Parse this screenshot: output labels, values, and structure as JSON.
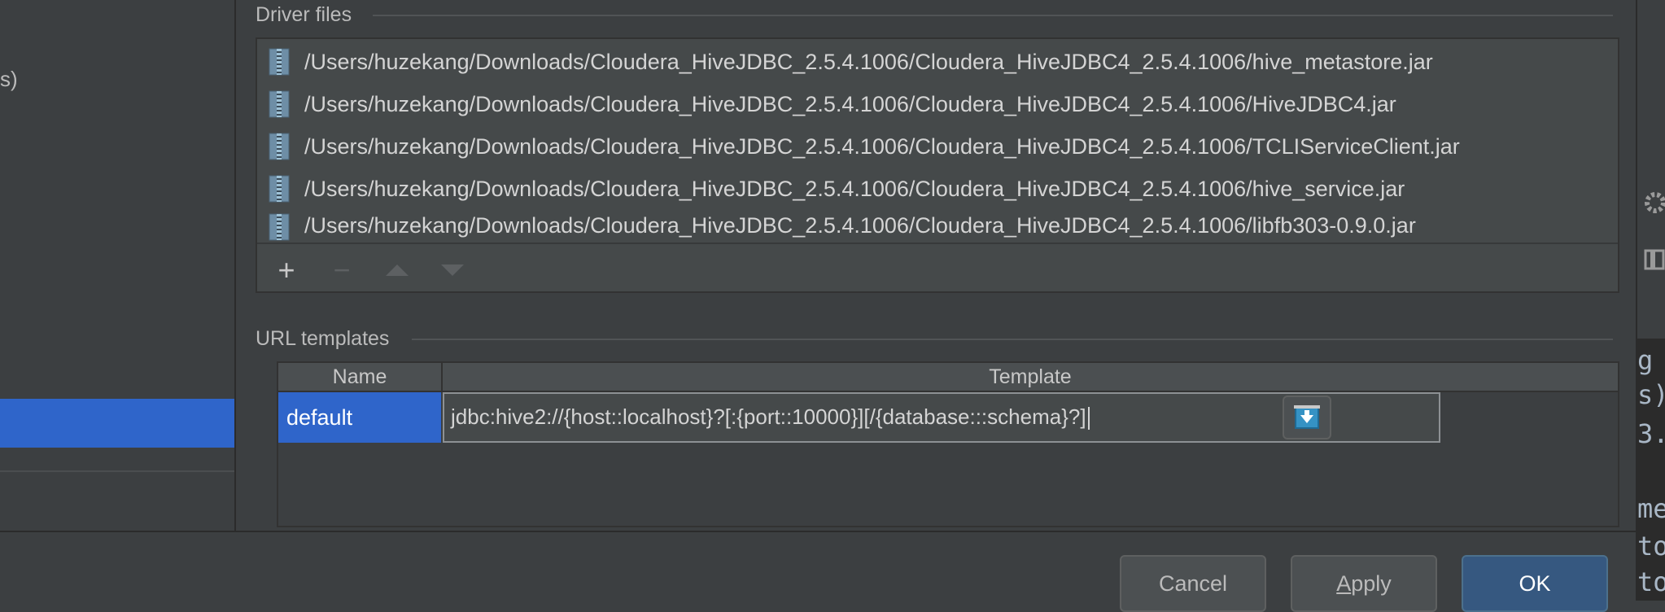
{
  "sidebar": {
    "partial_text": "s)"
  },
  "driver_files": {
    "section_label": "Driver files",
    "files": [
      "/Users/huzekang/Downloads/Cloudera_HiveJDBC_2.5.4.1006/Cloudera_HiveJDBC4_2.5.4.1006/hive_metastore.jar",
      "/Users/huzekang/Downloads/Cloudera_HiveJDBC_2.5.4.1006/Cloudera_HiveJDBC4_2.5.4.1006/HiveJDBC4.jar",
      "/Users/huzekang/Downloads/Cloudera_HiveJDBC_2.5.4.1006/Cloudera_HiveJDBC4_2.5.4.1006/TCLIServiceClient.jar",
      "/Users/huzekang/Downloads/Cloudera_HiveJDBC_2.5.4.1006/Cloudera_HiveJDBC4_2.5.4.1006/hive_service.jar",
      "/Users/huzekang/Downloads/Cloudera_HiveJDBC_2.5.4.1006/Cloudera_HiveJDBC4_2.5.4.1006/libfb303-0.9.0.jar"
    ],
    "toolbar": {
      "add": "+",
      "remove": "−"
    }
  },
  "url_templates": {
    "section_label": "URL templates",
    "columns": [
      "Name",
      "Template"
    ],
    "rows": [
      {
        "name": "default",
        "template": "jdbc:hive2://{host::localhost}?[:{port::10000}][/{database:::schema}?]"
      }
    ]
  },
  "buttons": {
    "cancel": "Cancel",
    "apply": "Apply",
    "ok": "OK"
  },
  "right_edge": {
    "lines": [
      "g",
      "s)",
      "3.",
      "me",
      "to",
      "to"
    ]
  },
  "colors": {
    "selection": "#2f65ca",
    "ok_button": "#365880",
    "background": "#3c3f41"
  }
}
